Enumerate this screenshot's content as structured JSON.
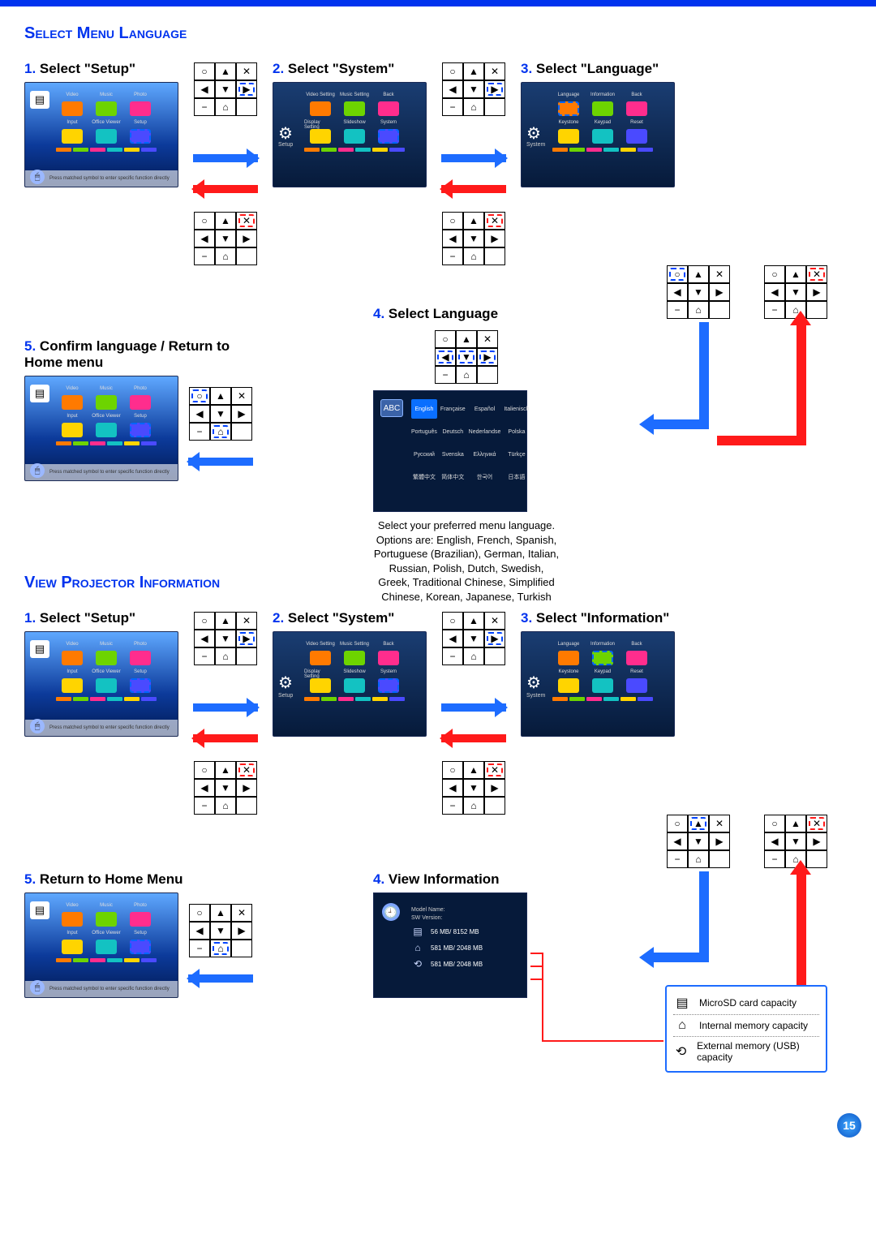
{
  "page_number": "15",
  "section1": {
    "title": "Select Menu Language",
    "step1": {
      "num": "1.",
      "text": "Select \"Setup\""
    },
    "step2": {
      "num": "2.",
      "text": "Select \"System\""
    },
    "step3": {
      "num": "3.",
      "text": "Select \"Language\""
    },
    "step4": {
      "num": "4.",
      "text": "Select Language"
    },
    "step5": {
      "num": "5.",
      "text": "Confirm language / Return to Home menu"
    },
    "home_menu": {
      "items": [
        "Video",
        "Music",
        "Photo",
        "Input",
        "Office Viewer",
        "Setup"
      ],
      "footer": "Press matched symbol to enter specific function directly"
    },
    "system_menu": {
      "items": [
        "Video Setting",
        "Music Setting",
        "Back",
        "Display Setting",
        "Slideshow",
        "System"
      ],
      "left_label": "Setup"
    },
    "setup_system_menu": {
      "items": [
        "Language",
        "Information",
        "Back",
        "Keystone",
        "Keypad",
        "Reset"
      ],
      "left_label": "System"
    },
    "language_caption": "Select your preferred menu language.\nOptions are: English, French, Spanish, Portuguese (Brazilian), German, Italian, Russian, Polish, Dutch, Swedish, Greek, Traditional Chinese, Simplified Chinese, Korean, Japanese, Turkish",
    "languages": [
      "English",
      "Française",
      "Español",
      "Italienisch",
      "Português",
      "Deutsch",
      "Nederlandse",
      "Polska",
      "Русский",
      "Svenska",
      "Ελληνικά",
      "Türkçe",
      "繁體中文",
      "简体中文",
      "한국어",
      "日本語"
    ]
  },
  "section2": {
    "title": "View Projector Information",
    "step1": {
      "num": "1.",
      "text": "Select \"Setup\""
    },
    "step2": {
      "num": "2.",
      "text": "Select \"System\""
    },
    "step3": {
      "num": "3.",
      "text": "Select \"Information\""
    },
    "step4": {
      "num": "4.",
      "text": "View Information"
    },
    "step5": {
      "num": "5.",
      "text": "Return to Home Menu"
    },
    "info_screen": {
      "model_label": "Model Name:",
      "sw_label": "SW Version:",
      "sd": "56 MB/ 8152 MB",
      "internal": "581 MB/ 2048 MB",
      "usb": "581 MB/ 2048 MB"
    },
    "legend": {
      "sd": "MicroSD card capacity",
      "internal": "Internal memory capacity",
      "usb": "External memory (USB) capacity"
    }
  },
  "icons": {
    "gear": "⚙",
    "clock": "🕘",
    "sd": "▤",
    "chip": "⌂",
    "usb": "⟲",
    "mouse": "🖱",
    "circle": "○",
    "up": "▲",
    "down": "▼",
    "left": "◀",
    "right": "▶",
    "x": "✕",
    "minus": "−",
    "home": "⌂"
  }
}
